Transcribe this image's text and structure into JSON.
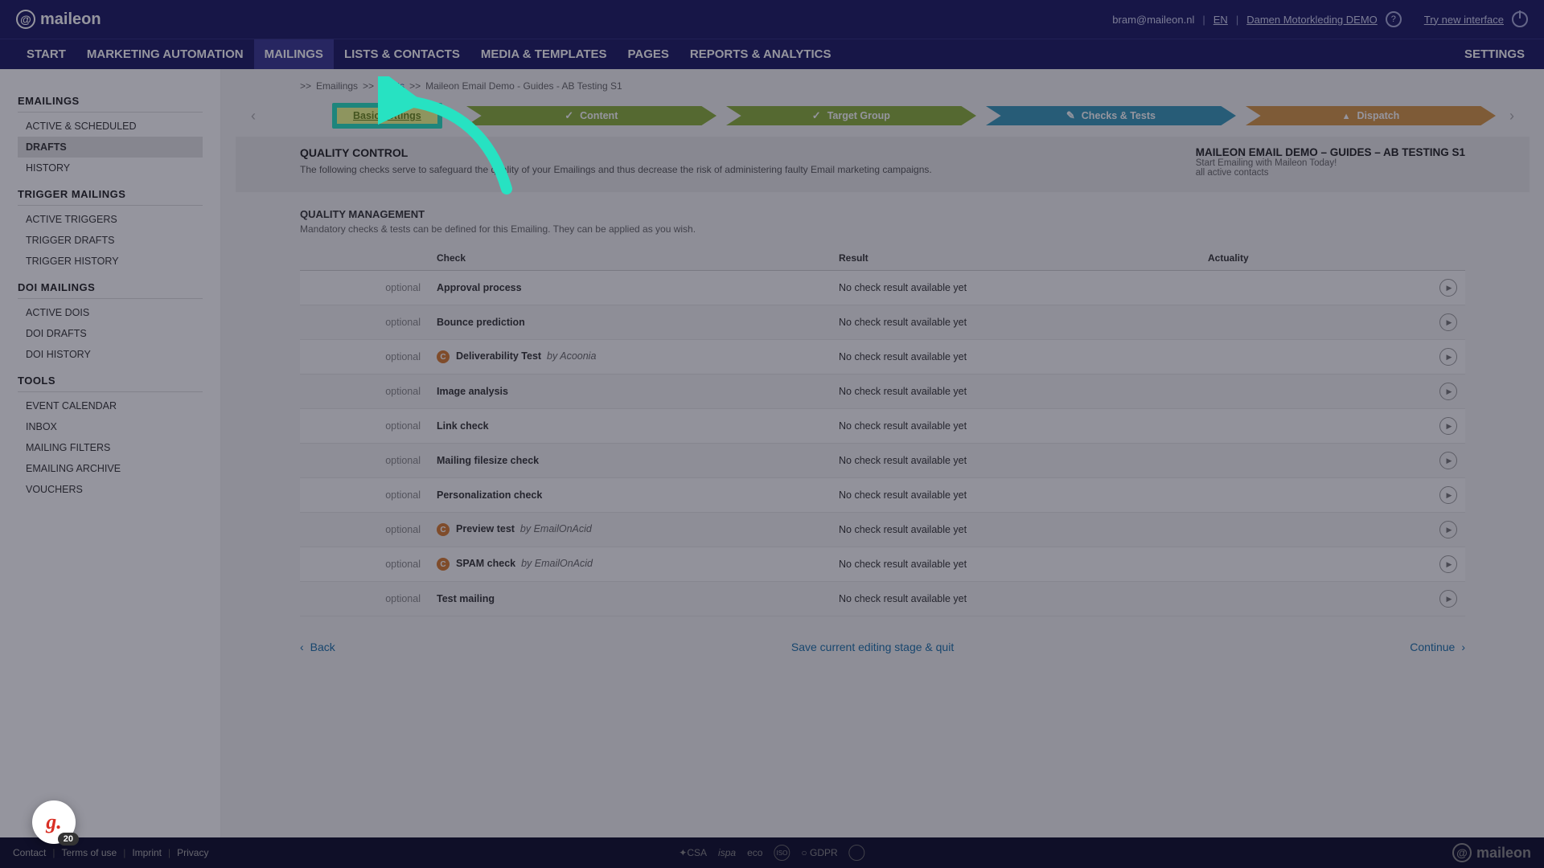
{
  "brand": "maileon",
  "topbar": {
    "user_email": "bram@maileon.nl",
    "lang": "EN",
    "account_link": "Damen Motorkleding DEMO",
    "try_new": "Try new interface"
  },
  "nav": {
    "items": [
      "START",
      "MARKETING AUTOMATION",
      "MAILINGS",
      "LISTS & CONTACTS",
      "MEDIA & TEMPLATES",
      "PAGES",
      "REPORTS & ANALYTICS"
    ],
    "active_index": 2,
    "settings": "SETTINGS"
  },
  "sidebar": {
    "groups": [
      {
        "heading": "EMAILINGS",
        "items": [
          "ACTIVE & SCHEDULED",
          "DRAFTS",
          "HISTORY"
        ],
        "active_index": 1
      },
      {
        "heading": "TRIGGER MAILINGS",
        "items": [
          "ACTIVE TRIGGERS",
          "TRIGGER DRAFTS",
          "TRIGGER HISTORY"
        ],
        "active_index": -1
      },
      {
        "heading": "DOI MAILINGS",
        "items": [
          "ACTIVE DOIS",
          "DOI DRAFTS",
          "DOI HISTORY"
        ],
        "active_index": -1
      },
      {
        "heading": "TOOLS",
        "items": [
          "EVENT CALENDAR",
          "INBOX",
          "MAILING FILTERS",
          "EMAILING ARCHIVE",
          "VOUCHERS"
        ],
        "active_index": -1
      }
    ]
  },
  "breadcrumb": {
    "sep": ">>",
    "parts": [
      {
        "text": "Emailings",
        "link": false
      },
      {
        "text": "Drafts",
        "link": true
      },
      {
        "text": "Maileon Email Demo - Guides - AB Testing S1",
        "link": false
      }
    ]
  },
  "steps": {
    "basic": "Basic settings",
    "content": "Content",
    "target": "Target Group",
    "checks": "Checks & Tests",
    "dispatch": "Dispatch"
  },
  "panel": {
    "qc_title": "QUALITY CONTROL",
    "qc_desc": "The following checks serve to safeguard the quality of your Emailings and thus decrease the risk of administering faulty Email marketing campaigns.",
    "mail_title": "MAILEON EMAIL DEMO – GUIDES – AB TESTING S1",
    "mail_line1": "Start Emailing with Maileon Today!",
    "mail_line2": "all active contacts"
  },
  "qm": {
    "heading": "QUALITY MANAGEMENT",
    "desc": "Mandatory checks & tests can be defined for this Emailing. They can be applied as you wish.",
    "col_check": "Check",
    "col_result": "Result",
    "col_actuality": "Actuality",
    "optional_label": "optional",
    "no_result": "No check result available yet",
    "rows": [
      {
        "name": "Approval process",
        "badge": false,
        "by": ""
      },
      {
        "name": "Bounce prediction",
        "badge": false,
        "by": ""
      },
      {
        "name": "Deliverability Test",
        "badge": true,
        "by": "by Acoonia"
      },
      {
        "name": "Image analysis",
        "badge": false,
        "by": ""
      },
      {
        "name": "Link check",
        "badge": false,
        "by": ""
      },
      {
        "name": "Mailing filesize check",
        "badge": false,
        "by": ""
      },
      {
        "name": "Personalization check",
        "badge": false,
        "by": ""
      },
      {
        "name": "Preview test",
        "badge": true,
        "by": "by EmailOnAcid"
      },
      {
        "name": "SPAM check",
        "badge": true,
        "by": "by EmailOnAcid"
      },
      {
        "name": "Test mailing",
        "badge": false,
        "by": ""
      }
    ]
  },
  "actions": {
    "back": "Back",
    "save": "Save current editing stage & quit",
    "continue": "Continue"
  },
  "footer": {
    "links": [
      "Contact",
      "Terms of use",
      "Imprint",
      "Privacy"
    ],
    "certs": [
      "CSA",
      "ispa",
      "eco",
      "ISO",
      "GDPR"
    ]
  },
  "grammarly_count": "20"
}
